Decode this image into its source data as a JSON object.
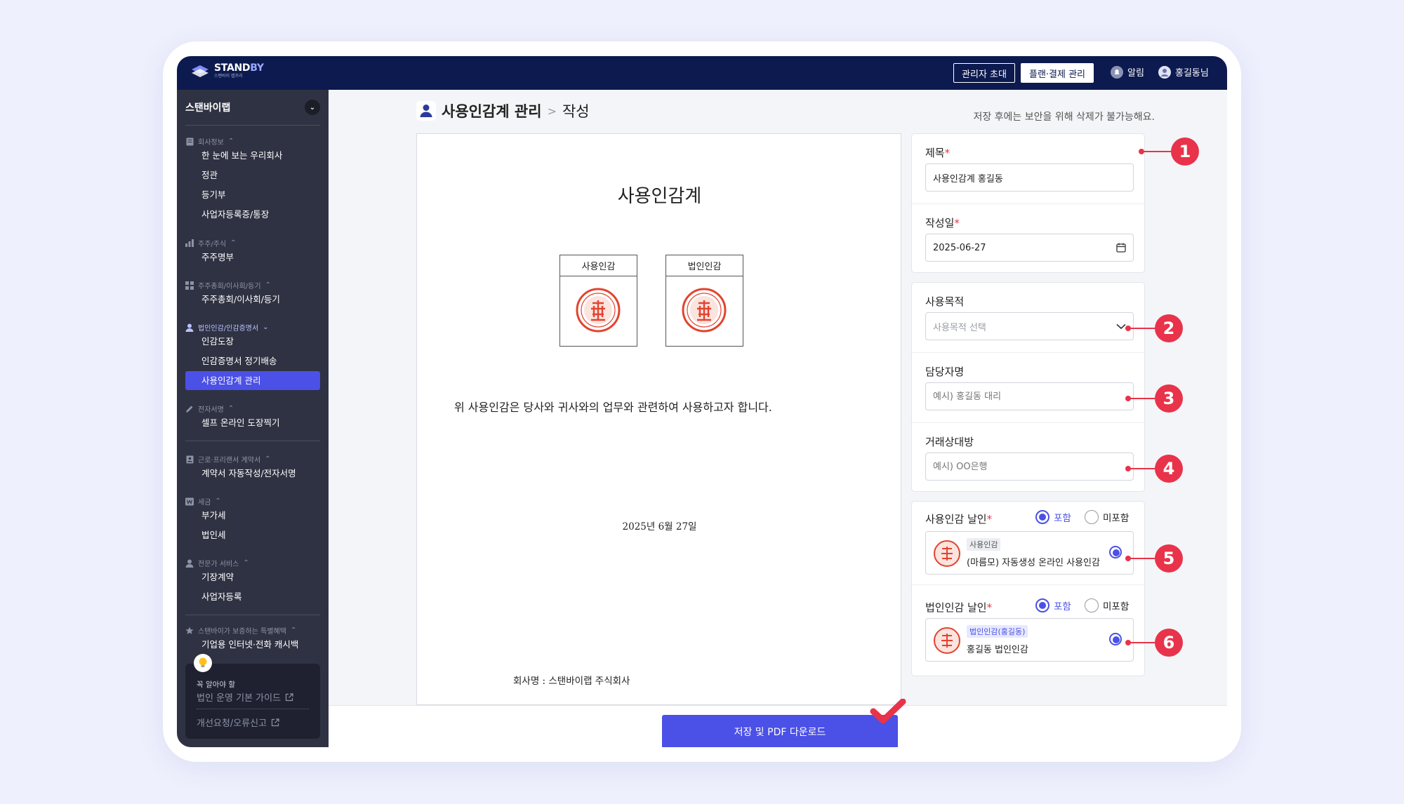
{
  "topbar": {
    "logo": {
      "text_a": "STAND",
      "text_b": "BY",
      "subtitle": "스탠바이 랩프리"
    },
    "invite_admin": "관리자 초대",
    "plan_billing": "플랜·결제 관리",
    "notifications": "알림",
    "user": "홍길동님"
  },
  "sidebar": {
    "company": "스탠바이랩",
    "sections": [
      {
        "title": "회사정보",
        "items": [
          "한 눈에 보는 우리회사",
          "정관",
          "등기부",
          "사업자등록증/통장"
        ]
      },
      {
        "title": "주주/주식",
        "items": [
          "주주명부"
        ]
      },
      {
        "title": "주주총회/이사회/등기",
        "items": [
          "주주총회/이사회/등기"
        ]
      },
      {
        "title": "법인인감/인감증명서",
        "items": [
          "인감도장",
          "인감증명서 정기배송",
          "사용인감계 관리"
        ]
      },
      {
        "title": "전자서명",
        "items": [
          "셀프 온라인 도장찍기"
        ]
      },
      {
        "title": "근로·프리랜서 계약서",
        "items": [
          "계약서 자동작성/전자서명"
        ]
      },
      {
        "title": "세금",
        "items": [
          "부가세",
          "법인세"
        ]
      },
      {
        "title": "전문가 서비스",
        "items": [
          "기장계약",
          "사업자등록"
        ]
      },
      {
        "title": "스탠바이가 보증하는 특별혜택",
        "items": [
          "기업용 인터넷·전화 캐시백"
        ]
      }
    ],
    "tip": {
      "small": "꼭 알아야 할",
      "guide": "법인 운영 기본 가이드",
      "report": "개선요청/오류신고"
    }
  },
  "header": {
    "title": "사용인감계 관리",
    "sep": ">",
    "sub": "작성",
    "note": "저장 후에는 보안을 위해 삭제가 불가능해요."
  },
  "document": {
    "title": "사용인감계",
    "seal_left": "사용인감",
    "seal_right": "법인인감",
    "seal_glyph": "理代事表",
    "body": "위 사용인감은 당사와 귀사와의 업무와 관련하여 사용하고자 합니다.",
    "date": "2025년 6월 27일",
    "company": "회사명 : 스탠바이랩 주식회사"
  },
  "form": {
    "title_label": "제목",
    "title_value": "사용인감계 홍길동",
    "date_label": "작성일",
    "date_value": "2025-06-27",
    "purpose_label": "사용목적",
    "purpose_placeholder": "사용목적 선택",
    "manager_label": "담당자명",
    "manager_placeholder": "예시) 홍길동 대리",
    "partner_label": "거래상대방",
    "partner_placeholder": "예시) OO은행",
    "req_mark": "*",
    "seal_use_label": "사용인감 날인",
    "include": "포함",
    "exclude": "미포함",
    "seal_use_tag": "사용인감",
    "seal_use_name": "(마름모) 자동생성 온라인 사용인감",
    "seal_corp_label": "법인인감 날인",
    "seal_corp_tag": "법인인감(홍길동)",
    "seal_corp_name": "홍길동 법인인감"
  },
  "footer": {
    "save": "저장 및 PDF 다운로드"
  },
  "callouts": [
    "1",
    "2",
    "3",
    "4",
    "5",
    "6"
  ],
  "colors": {
    "accent": "#4b50e6",
    "topbar": "#0c1a4f",
    "sidebar": "#2f3242",
    "callout": "#e8334a",
    "seal": "#e1442f"
  }
}
